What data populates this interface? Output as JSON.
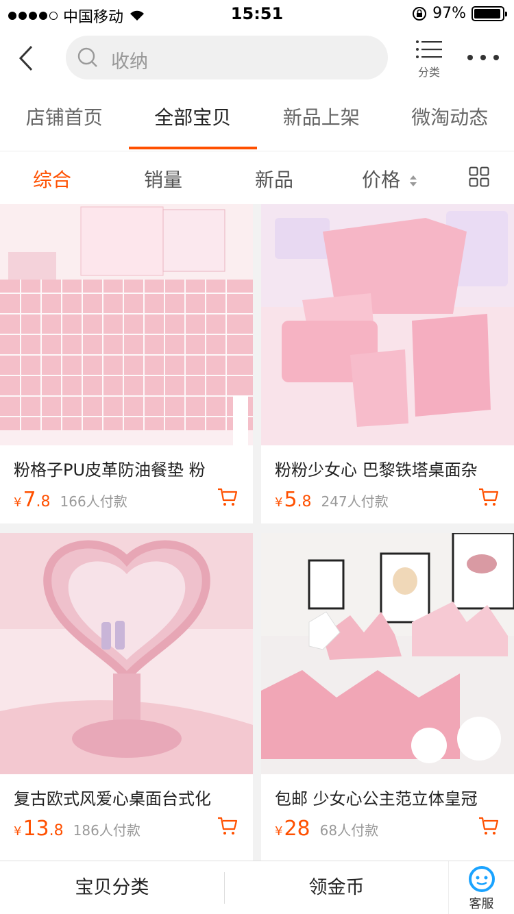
{
  "status_bar": {
    "carrier": "中国移动",
    "time": "15:51",
    "battery": "97%"
  },
  "search": {
    "placeholder": "收纳"
  },
  "header": {
    "category_label": "分类"
  },
  "tabs": [
    {
      "label": "店铺首页"
    },
    {
      "label": "全部宝贝"
    },
    {
      "label": "新品上架"
    },
    {
      "label": "微淘动态"
    }
  ],
  "filters": [
    {
      "label": "综合"
    },
    {
      "label": "销量"
    },
    {
      "label": "新品"
    },
    {
      "label": "价格"
    }
  ],
  "products": [
    {
      "title": "粉格子PU皮革防油餐垫 粉",
      "currency": "¥",
      "price_int": "7",
      "price_dec": ".8",
      "sales": "166人付款"
    },
    {
      "title": "粉粉少女心 巴黎铁塔桌面杂",
      "currency": "¥",
      "price_int": "5",
      "price_dec": ".8",
      "sales": "247人付款"
    },
    {
      "title": "复古欧式风爱心桌面台式化",
      "currency": "¥",
      "price_int": "13",
      "price_dec": ".8",
      "sales": "186人付款"
    },
    {
      "title": "包邮 少女心公主范立体皇冠",
      "currency": "¥",
      "price_int": "28",
      "price_dec": "",
      "sales": "68人付款"
    }
  ],
  "bottom_bar": {
    "category": "宝贝分类",
    "coins": "领金币",
    "service": "客服"
  },
  "colors": {
    "accent": "#ff5000",
    "pink": "#f6c7d0"
  }
}
